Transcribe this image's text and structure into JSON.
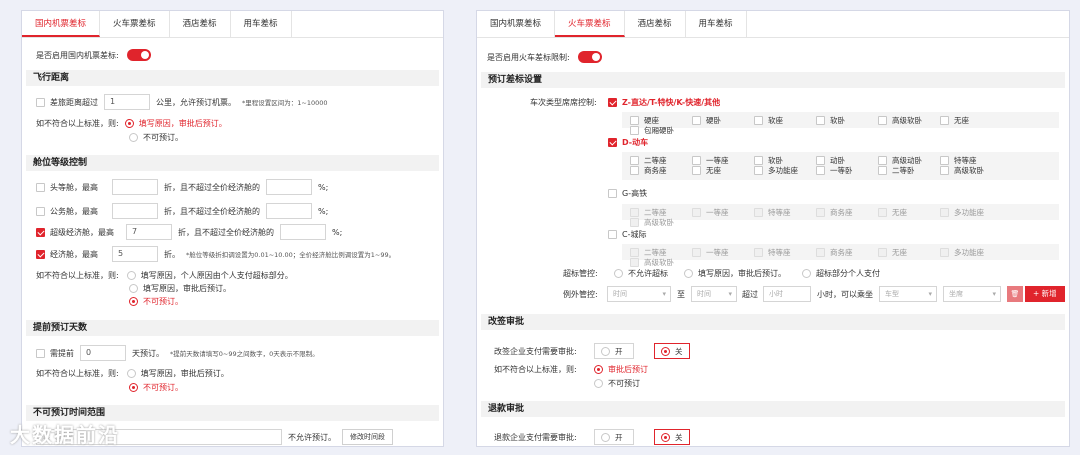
{
  "left": {
    "tabs": [
      "国内机票差标",
      "火车票差标",
      "酒店差标",
      "用车差标"
    ],
    "enable_label": "是否启用国内机票差标:",
    "sec_distance": "飞行距离",
    "dist_label": "差旅距离超过",
    "dist_value": "1",
    "dist_suffix": "公里，允许预订机票。",
    "dist_note": "*里程设置区间为：1~10000",
    "if_fail": "如不符合以上标准，则:",
    "opt_reason": "填写原因，审批后预订。",
    "opt_no": "不可预订。",
    "sec_cabin": "舱位等级控制",
    "first_label": "头等舱，最高",
    "biz_label": "公务舱，最高",
    "super_label": "超级经济舱，最高",
    "eco_label": "经济舱，最高",
    "discount_mid": "折，且不超过全价经济舱的",
    "discount_end": "折。",
    "percent": "%;",
    "super_value": "7",
    "eco_value": "5",
    "cabin_note": "*舱位等级折扣调设置为0.01~10.00；全价经济舱比例调设置为1~99。",
    "opt_personal": "填写原因，个人原因由个人支付超标部分。",
    "sec_advance": "提前预订天数",
    "adv_label": "需提前",
    "adv_value": "0",
    "adv_suffix": "天预订。",
    "adv_note": "*提前天数请填写0~99之间数字，0天表示不限制。",
    "opt_reason2": "填写原因，审批后预订。",
    "sec_time": "不可预订时间范围",
    "time_placeholder": "起飞时间",
    "time_suffix": "不允许预订。",
    "modify_btn": "修改时间段"
  },
  "right": {
    "tabs": [
      "国内机票差标",
      "火车票差标",
      "酒店差标",
      "用车差标"
    ],
    "enable_label": "是否启用火车差标限制:",
    "sec_booking": "预订差标设置",
    "seat_label": "车次类型席席控制:",
    "z_label": "Z-直达/T-特快/K-快速/其他",
    "z_opts": [
      "硬座",
      "硬卧",
      "软座",
      "软卧",
      "高级软卧",
      "无座",
      "包厢硬卧"
    ],
    "d_label": "D-动车",
    "d_opts": [
      "二等座",
      "一等座",
      "软卧",
      "动卧",
      "高级动卧",
      "特等座",
      "商务座",
      "无座",
      "多功能座",
      "一等卧",
      "二等卧",
      "高级软卧"
    ],
    "g_label": "G-高铁",
    "g_opts": [
      "二等座",
      "一等座",
      "特等座",
      "商务座",
      "无座",
      "多功能座",
      "高级软卧"
    ],
    "c_label": "C-城际",
    "c_opts": [
      "二等座",
      "一等座",
      "特等座",
      "商务座",
      "无座",
      "多功能座",
      "高级软卧"
    ],
    "over_label": "超标管控:",
    "over_opts": [
      "不允许超标",
      "填写原因，审批后预订。",
      "超标部分个人支付"
    ],
    "exc_label": "例外管控:",
    "exc_time1": "时间",
    "exc_to": "至",
    "exc_time2": "时间",
    "exc_over": "超过",
    "exc_hours": "小时",
    "exc_hours_suffix": "小时，可以乘坐",
    "exc_train": "车型",
    "exc_seat": "坐席",
    "add_btn": "+ 新增",
    "sec_change": "改签审批",
    "change_label": "改签企业支付需要审批:",
    "on": "开",
    "off": "关",
    "if_fail": "如不符合以上标准，则:",
    "change_opt1": "审批后预订",
    "change_opt2": "不可预订",
    "sec_refund": "退款审批",
    "refund_label": "退款企业支付需要审批:"
  },
  "watermark": "大数据前沿"
}
